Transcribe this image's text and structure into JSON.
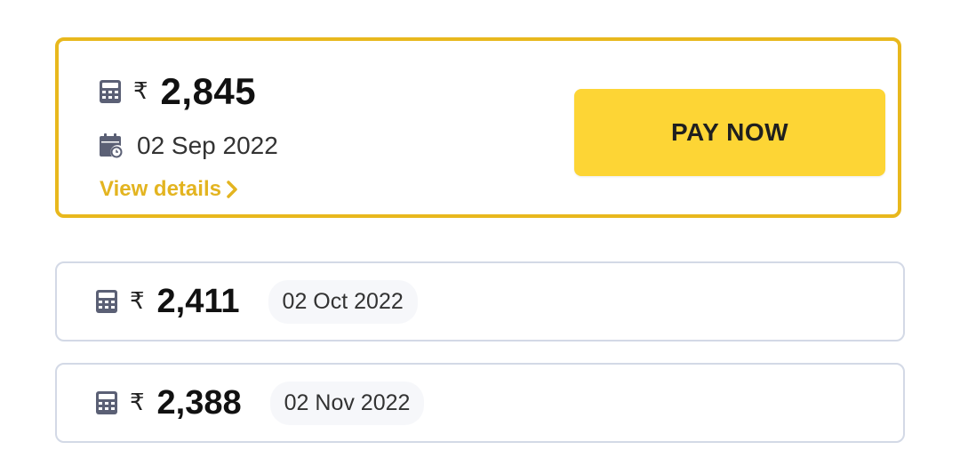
{
  "currency_symbol": "₹",
  "current": {
    "amount": "2,845",
    "due_date": "02 Sep 2022",
    "view_details_label": "View details",
    "pay_button_label": "PAY NOW"
  },
  "upcoming": [
    {
      "amount": "2,411",
      "due_date": "02 Oct 2022"
    },
    {
      "amount": "2,388",
      "due_date": "02 Nov 2022"
    }
  ],
  "colors": {
    "accent_border": "#e8b81d",
    "pay_button": "#fdd535",
    "link": "#e3b420",
    "icon": "#5b6075",
    "card_border": "#d3d9e6"
  },
  "icons": {
    "amount": "calculator-icon",
    "date": "calendar-clock-icon",
    "link_arrow": "chevron-right-icon"
  }
}
